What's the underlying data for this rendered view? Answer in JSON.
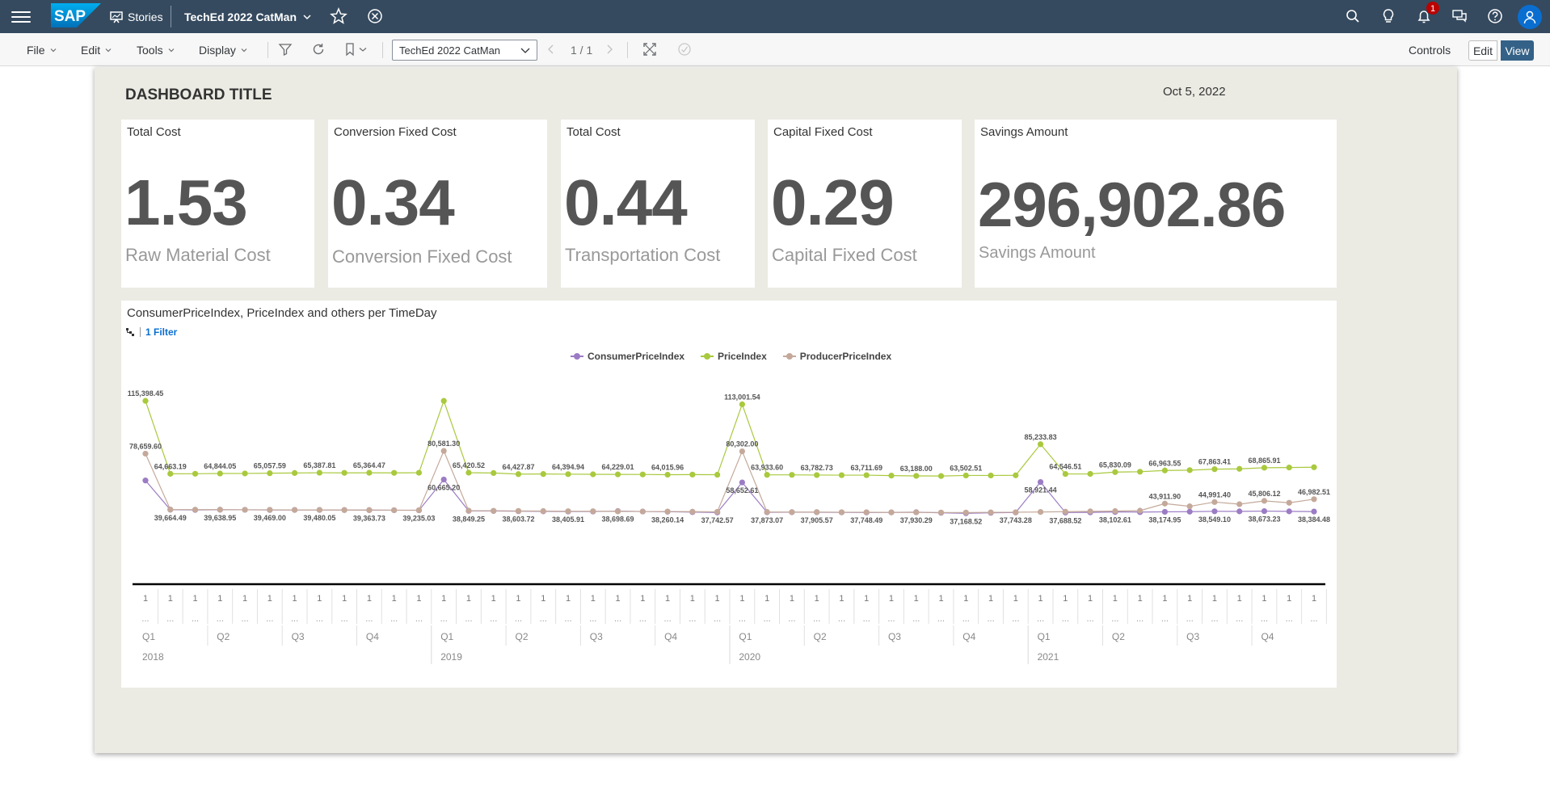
{
  "shell": {
    "stories_label": "Stories",
    "story_name": "TechEd 2022 CatMan",
    "notification_count": "1",
    "brand_color": "#354a5f"
  },
  "toolbar": {
    "file_label": "File",
    "edit_label": "Edit",
    "tools_label": "Tools",
    "display_label": "Display",
    "page_select_value": "TechEd 2022 CatMan",
    "page_count": "1 / 1",
    "controls_label": "Controls",
    "edit_mode_label": "Edit",
    "view_mode_label": "View"
  },
  "dashboard": {
    "title": "DASHBOARD TITLE",
    "date": "Oct 5, 2022",
    "tiles": [
      {
        "title": "Total Cost",
        "value": "1.53",
        "label": "Raw Material Cost"
      },
      {
        "title": "Conversion Fixed Cost",
        "value": "0.34",
        "label": "Conversion Fixed Cost"
      },
      {
        "title": "Total Cost",
        "value": "0.44",
        "label": "Transportation Cost"
      },
      {
        "title": "Capital Fixed Cost",
        "value": "0.29",
        "label": "Capital Fixed Cost"
      },
      {
        "title": "Savings Amount",
        "value": "296,902.86",
        "label": "Savings Amount"
      }
    ],
    "chart_title": "ConsumerPriceIndex, PriceIndex and others per TimeDay",
    "filter_label": "1 Filter"
  },
  "chart_data": {
    "type": "line",
    "title": "ConsumerPriceIndex, PriceIndex and others per TimeDay",
    "x_tick_labels": [
      "1",
      "..."
    ],
    "quarters": [
      "Q1",
      "Q2",
      "Q3",
      "Q4"
    ],
    "years": [
      "2018",
      "2019",
      "2020",
      "2021"
    ],
    "points_per_year": 12,
    "series": [
      {
        "name": "ConsumerPriceIndex",
        "color": "#9b7cc4",
        "values": [
          60000,
          39664.49,
          39500,
          39638.95,
          39600,
          39469.0,
          39500,
          39480.05,
          39450,
          39363.73,
          39300,
          39235.03,
          60665.2,
          38849.25,
          38800,
          38603.72,
          38500,
          38405.91,
          38400,
          38698.69,
          38400,
          38260.14,
          38000,
          37742.57,
          58652.61,
          37873.07,
          37900,
          37905.57,
          37800,
          37748.49,
          37800,
          37930.29,
          37500,
          37168.52,
          37500,
          37743.28,
          58921.44,
          37688.52,
          37800,
          38102.61,
          38000,
          38174.95,
          38300,
          38549.1,
          38500,
          38673.23,
          38500,
          38384.48
        ]
      },
      {
        "name": "PriceIndex",
        "color": "#a9c93e",
        "values": [
          115398.45,
          64663.19,
          64700,
          64844.05,
          64900,
          65057.59,
          65200,
          65387.81,
          65300,
          65364.47,
          65300,
          65400,
          115398.45,
          65420.52,
          65200,
          64427.87,
          64500,
          64394.94,
          64300,
          64229.01,
          64200,
          64015.96,
          64100,
          64000,
          113001.54,
          63933.6,
          63900,
          63782.73,
          63700,
          63711.69,
          63400,
          63188.0,
          63100,
          63502.51,
          63500,
          63600,
          85233.83,
          64546.51,
          64600,
          65830.09,
          66100,
          66963.55,
          67200,
          67863.41,
          68100,
          68865.91,
          69000,
          69200
        ]
      },
      {
        "name": "ProducerPriceIndex",
        "color": "#c4a99a",
        "values": [
          78659.6,
          39800,
          39700,
          39700,
          39600,
          39600,
          39500,
          39500,
          39400,
          39400,
          39300,
          39300,
          80581.3,
          39000,
          38900,
          38800,
          38700,
          38600,
          38600,
          38500,
          38400,
          38400,
          38300,
          38200,
          80302.0,
          38100,
          38000,
          38000,
          37900,
          37900,
          37800,
          37800,
          37700,
          37700,
          37800,
          37900,
          38100,
          38300,
          38500,
          38700,
          39000,
          43911.9,
          42000,
          44991.4,
          43500,
          45806.12,
          44500,
          46982.51
        ]
      }
    ],
    "data_labels": {
      "ConsumerPriceIndex": [
        "39,664.49",
        "39,638.95",
        "39,469.00",
        "39,480.05",
        "39,363.73",
        "39,235.03",
        "60,665.20",
        "38,849.25",
        "38,603.72",
        "38,405.91",
        "38,698.69",
        "38,260.14",
        "37,742.57",
        "58,652.61",
        "37,873.07",
        "37,905.57",
        "37,748.49",
        "37,930.29",
        "37,168.52",
        "37,743.28",
        "58,921.44",
        "37,688.52",
        "38,102.61",
        "38,174.95",
        "38,549.10",
        "38,673.23",
        "38,384.48"
      ],
      "PriceIndex": [
        "115,398.45",
        "64,663.19",
        "64,844.05",
        "65,057.59",
        "65,387.81",
        "65,364.47",
        "65,420.52",
        "64,427.87",
        "64,394.94",
        "64,229.01",
        "64,015.96",
        "113,001.54",
        "63,933.60",
        "63,782.73",
        "63,711.69",
        "63,188.00",
        "63,502.51",
        "85,233.83",
        "64,546.51",
        "65,830.09",
        "66,963.55",
        "67,863.41",
        "68,865.91"
      ],
      "ProducerPriceIndex": [
        "78,659.60",
        "80,581.30",
        "80,302.00",
        "43,911.90",
        "44,991.40",
        "45,806.12",
        "46,982.51"
      ]
    }
  }
}
